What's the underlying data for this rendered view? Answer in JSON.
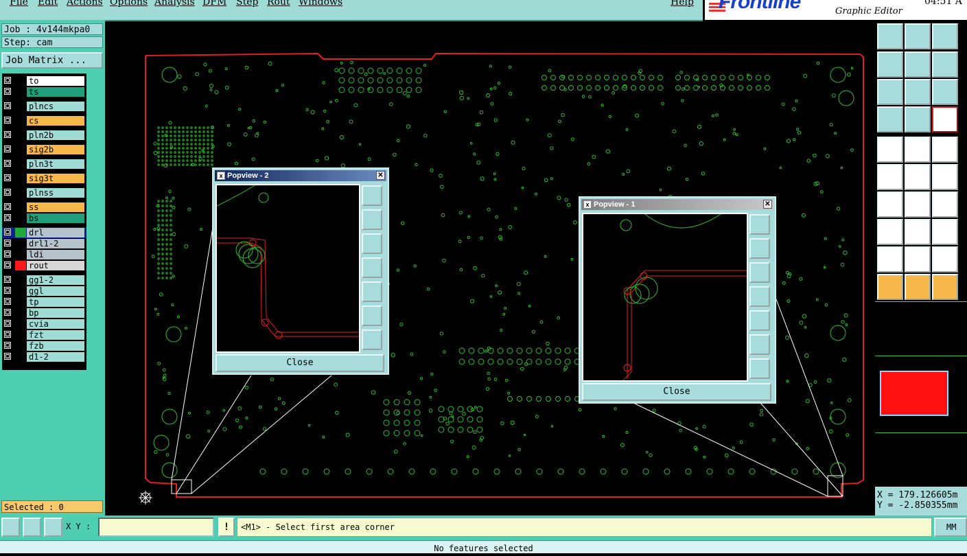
{
  "menubar": {
    "items": [
      "File",
      "Edit",
      "Actions",
      "Options",
      "Analysis",
      "DFM",
      "Step",
      "Rout",
      "Windows"
    ],
    "help": "Help"
  },
  "brand": {
    "name": "Frontline",
    "subtitle": "Graphic Editor",
    "clock": "04:51 A"
  },
  "job": {
    "job_label": "Job : 4v144mkpa0",
    "step_label": "Step: cam",
    "matrix_button": "Job Matrix ..."
  },
  "layers": [
    {
      "name": "to",
      "color": "#ffffff"
    },
    {
      "name": "ts",
      "color": "#1fa07a"
    },
    {
      "name": "plncs",
      "color": "#9fdcd6"
    },
    {
      "name": "cs",
      "color": "#f6b84a"
    },
    {
      "name": "pln2b",
      "color": "#9fdcd6"
    },
    {
      "name": "sig2b",
      "color": "#f6b84a"
    },
    {
      "name": "pln3t",
      "color": "#9fdcd6"
    },
    {
      "name": "sig3t",
      "color": "#f6b84a"
    },
    {
      "name": "plnss",
      "color": "#9fdcd6"
    },
    {
      "name": "ss",
      "color": "#f6b84a"
    },
    {
      "name": "bs",
      "color": "#1fa07a"
    },
    {
      "name": "drl",
      "color": "#b4c3cc",
      "active": true
    },
    {
      "name": "drl1-2",
      "color": "#b4c3cc"
    },
    {
      "name": "ldi",
      "color": "#b4c3cc"
    },
    {
      "name": "rout",
      "color": "#d8d8d8",
      "display": true
    },
    {
      "name": "gg1-2",
      "color": "#9fdcd6"
    },
    {
      "name": "ggl",
      "color": "#9fdcd6"
    },
    {
      "name": "tp",
      "color": "#9fdcd6"
    },
    {
      "name": "bp",
      "color": "#9fdcd6"
    },
    {
      "name": "cvia",
      "color": "#9fdcd6"
    },
    {
      "name": "fzt",
      "color": "#9fdcd6"
    },
    {
      "name": "fzb",
      "color": "#9fdcd6"
    },
    {
      "name": "d1-2",
      "color": "#9fdcd6"
    }
  ],
  "selected": "Selected : 0",
  "popups": [
    {
      "title": "Popview - 2",
      "close_label": "Close",
      "close_icon": "x-icon"
    },
    {
      "title": "Popview - 1",
      "close_label": "Close",
      "close_icon": "x-icon"
    }
  ],
  "coords": {
    "x": "X = 179.126605m",
    "y": "Y = -2.850355mm"
  },
  "bottombar": {
    "xy_label": "X Y :",
    "xy_value": "",
    "excl": "!",
    "prompt": "<M1> - Select first area corner",
    "units": "MM"
  },
  "status": "No features selected",
  "colors": {
    "board_outline": "#e02020",
    "pads": "#2fbf2f",
    "panel": "#4fcfb2",
    "button": "#a8dcdc"
  }
}
